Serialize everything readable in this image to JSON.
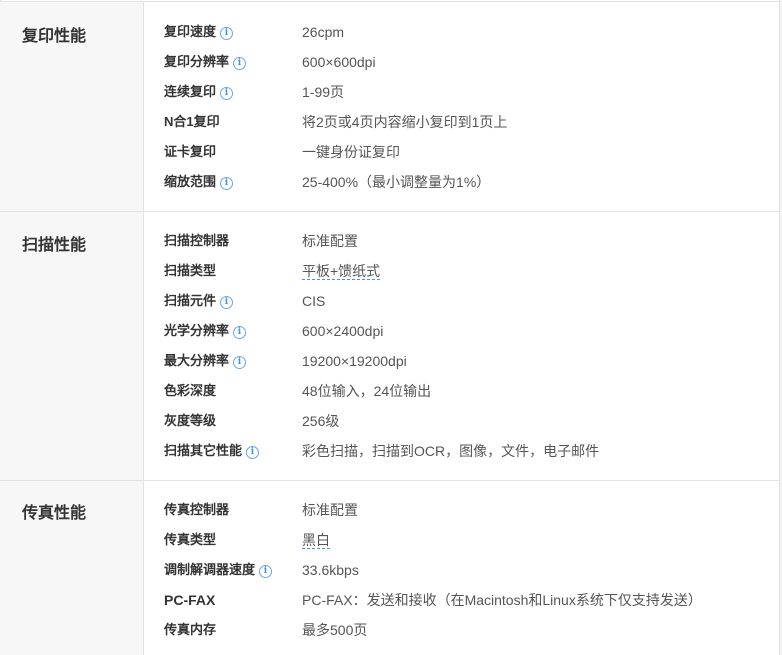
{
  "sections": [
    {
      "title": "复印性能",
      "rows": [
        {
          "label": "复印速度",
          "value": "26cpm",
          "info": true
        },
        {
          "label": "复印分辨率",
          "value": "600×600dpi",
          "info": true
        },
        {
          "label": "连续复印",
          "value": "1-99页",
          "info": true
        },
        {
          "label": "N合1复印",
          "value": "将2页或4页内容缩小复印到1页上",
          "info": false
        },
        {
          "label": "证卡复印",
          "value": "一键身份证复印",
          "info": false
        },
        {
          "label": "缩放范围",
          "value": "25-400%（最小调整量为1%）",
          "info": true
        }
      ]
    },
    {
      "title": "扫描性能",
      "rows": [
        {
          "label": "扫描控制器",
          "value": "标准配置",
          "info": false
        },
        {
          "label": "扫描类型",
          "value": "平板+馈纸式",
          "info": false,
          "dashed": true
        },
        {
          "label": "扫描元件",
          "value": "CIS",
          "info": true
        },
        {
          "label": "光学分辨率",
          "value": "600×2400dpi",
          "info": true
        },
        {
          "label": "最大分辨率",
          "value": "19200×19200dpi",
          "info": true
        },
        {
          "label": "色彩深度",
          "value": "48位输入，24位输出",
          "info": false
        },
        {
          "label": "灰度等级",
          "value": "256级",
          "info": false
        },
        {
          "label": "扫描其它性能",
          "value": "彩色扫描，扫描到OCR，图像，文件，电子邮件",
          "info": true
        }
      ]
    },
    {
      "title": "传真性能",
      "rows": [
        {
          "label": "传真控制器",
          "value": "标准配置",
          "info": false
        },
        {
          "label": "传真类型",
          "value": "黑白",
          "info": false,
          "dashed": true
        },
        {
          "label": "调制解调器速度",
          "value": "33.6kbps",
          "info": true
        },
        {
          "label": "PC-FAX",
          "value": "PC-FAX：发送和接收（在Macintosh和Linux系统下仅支持发送）",
          "info": false
        },
        {
          "label": "传真内存",
          "value": "最多500页",
          "info": false
        }
      ]
    }
  ],
  "info_glyph": "i",
  "colors": {
    "info_icon": "#4a90e2",
    "section_bg": "#f7f7f7",
    "border": "#e3e3e3"
  }
}
